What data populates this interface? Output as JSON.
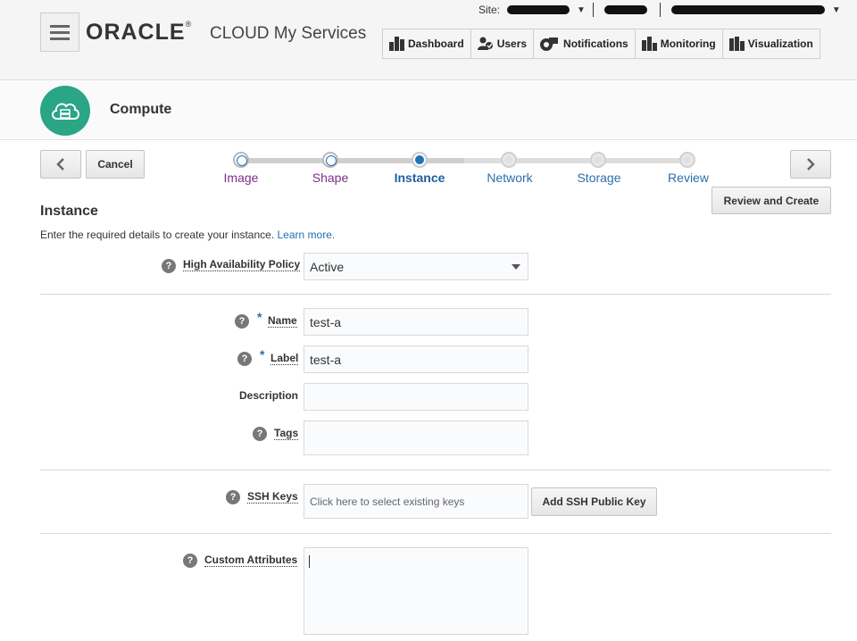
{
  "header": {
    "logo_text": "ORACLE",
    "logo_mark": "®",
    "product_title": "CLOUD My Services",
    "site_label": "Site:",
    "nav": [
      {
        "label": "Dashboard",
        "icon": "dashboard-icon"
      },
      {
        "label": "Users",
        "icon": "users-icon"
      },
      {
        "label": "Notifications",
        "icon": "notifications-icon"
      },
      {
        "label": "Monitoring",
        "icon": "monitoring-icon"
      },
      {
        "label": "Visualization",
        "icon": "visualization-icon"
      }
    ]
  },
  "service": {
    "title": "Compute",
    "icon": "cloud-server-icon",
    "accent_color": "#2aa586"
  },
  "wizard": {
    "cancel_label": "Cancel",
    "back_icon": "chevron-left-icon",
    "next_icon": "chevron-right-icon",
    "review_create_label": "Review and Create",
    "steps": [
      {
        "label": "Image",
        "state": "visited"
      },
      {
        "label": "Shape",
        "state": "visited"
      },
      {
        "label": "Instance",
        "state": "current"
      },
      {
        "label": "Network",
        "state": "future"
      },
      {
        "label": "Storage",
        "state": "future"
      },
      {
        "label": "Review",
        "state": "future"
      }
    ]
  },
  "form": {
    "section_title": "Instance",
    "intro_text": "Enter the required details to create your instance.",
    "learn_more_label": "Learn more.",
    "help_glyph": "?",
    "required_mark": "*",
    "ha_policy": {
      "label": "High Availability Policy",
      "value": "Active"
    },
    "name": {
      "label": "Name",
      "value": "test-a"
    },
    "label_field": {
      "label": "Label",
      "value": "test-a"
    },
    "description": {
      "label": "Description",
      "value": ""
    },
    "tags": {
      "label": "Tags",
      "value": ""
    },
    "ssh_keys": {
      "label": "SSH Keys",
      "placeholder": "Click here to select existing keys",
      "add_label": "Add SSH Public Key"
    },
    "custom_attributes": {
      "label": "Custom Attributes",
      "value": ""
    }
  }
}
